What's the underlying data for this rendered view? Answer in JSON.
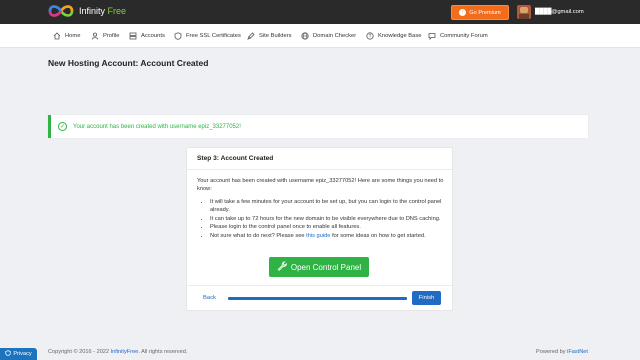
{
  "header": {
    "logo_word1": "Infinity",
    "logo_word2": "Free",
    "premium_label": "Go Premium",
    "user_email": "████@gmail.com",
    "brand_color": "#7dd23a",
    "premium_color": "#f26c1a"
  },
  "nav": {
    "items": [
      {
        "label": "Home",
        "icon": "home-icon"
      },
      {
        "label": "Profile",
        "icon": "user-icon"
      },
      {
        "label": "Accounts",
        "icon": "server-icon"
      },
      {
        "label": "Free SSL Certificates",
        "icon": "shield-icon"
      },
      {
        "label": "Site Builders",
        "icon": "brush-icon"
      },
      {
        "label": "Domain Checker",
        "icon": "globe-icon"
      },
      {
        "label": "Knowledge Base",
        "icon": "help-icon"
      },
      {
        "label": "Community Forum",
        "icon": "chat-icon"
      }
    ]
  },
  "page": {
    "title": "New Hosting Account: Account Created"
  },
  "alert": {
    "message": "Your account has been created with username epiz_33277052!",
    "color": "#2fb344"
  },
  "card": {
    "header": "Step 3: Account Created",
    "intro": "Your account has been created with username epiz_33277052! Here are some things you need to know:",
    "bullets": [
      "It will take a few minutes for your account to be set up, but you can login to the control panel already.",
      "It can take up to 72 hours for the new domain to be visible everywhere due to DNS caching.",
      "Please login to the control panel once to enable all features."
    ],
    "last_bullet_prefix": "Not sure what to do next? Please see ",
    "last_bullet_link": "this guide",
    "last_bullet_suffix": " for some ideas on how to get started.",
    "open_cp_label": "Open Control Panel",
    "back_label": "Back",
    "finish_label": "Finish",
    "progress_percent": 100
  },
  "footer": {
    "copyright_prefix": "Copyright © 2016 - 2022 ",
    "copyright_link": "InfinityFree",
    "copyright_suffix": ". All rights reserved.",
    "powered_prefix": "Powered by ",
    "powered_link": "iFastNet",
    "privacy_label": "Privacy"
  }
}
